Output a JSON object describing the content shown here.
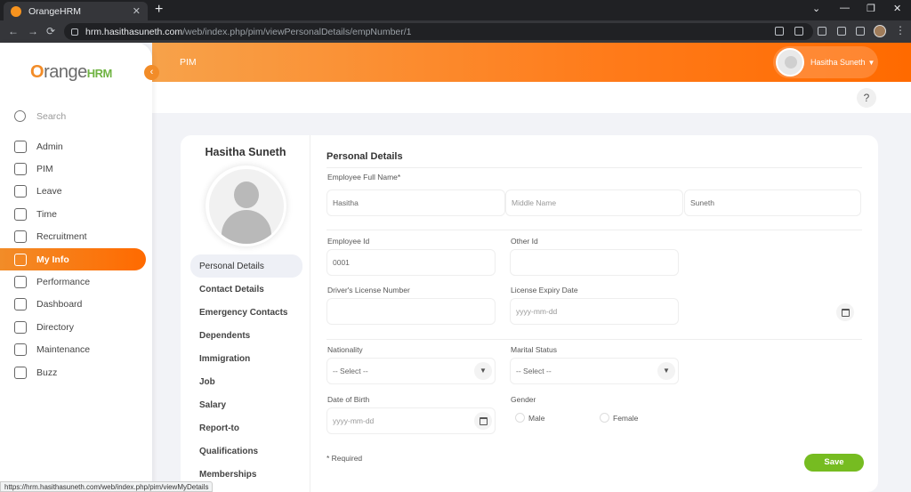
{
  "browser": {
    "tab_title": "OrangeHRM",
    "tab_close": "✕",
    "new_tab": "+",
    "url_host": "hrm.hasithasuneth.com",
    "url_path": "/web/index.php/pim/viewPersonalDetails/empNumber/1",
    "status_url": "https://hrm.hasithasuneth.com/web/index.php/pim/viewMyDetails",
    "controls": {
      "minimize": "—",
      "maximize": "❐",
      "close": "✕",
      "expand": "⌄"
    },
    "nav": {
      "back": "←",
      "forward": "→",
      "reload": "⟳"
    },
    "menu": "⋮"
  },
  "sidebar": {
    "logo_o": "O",
    "logo_text": "range",
    "logo_hrm": "HRM",
    "collapse": "‹",
    "search_placeholder": "Search",
    "items": [
      {
        "label": "Admin"
      },
      {
        "label": "PIM"
      },
      {
        "label": "Leave"
      },
      {
        "label": "Time"
      },
      {
        "label": "Recruitment"
      },
      {
        "label": "My Info",
        "active": true
      },
      {
        "label": "Performance"
      },
      {
        "label": "Dashboard"
      },
      {
        "label": "Directory"
      },
      {
        "label": "Maintenance"
      },
      {
        "label": "Buzz"
      }
    ]
  },
  "header": {
    "module": "PIM",
    "user_name": "Hasitha Suneth",
    "caret": "▼",
    "help": "?"
  },
  "profile": {
    "name": "Hasitha Suneth",
    "tabs": [
      {
        "label": "Personal Details",
        "active": true
      },
      {
        "label": "Contact Details"
      },
      {
        "label": "Emergency Contacts"
      },
      {
        "label": "Dependents"
      },
      {
        "label": "Immigration"
      },
      {
        "label": "Job"
      },
      {
        "label": "Salary"
      },
      {
        "label": "Report-to"
      },
      {
        "label": "Qualifications"
      },
      {
        "label": "Memberships"
      }
    ]
  },
  "form": {
    "title": "Personal Details",
    "full_name_label": "Employee Full Name*",
    "first_name": "Hasitha",
    "middle_name_placeholder": "Middle Name",
    "last_name": "Suneth",
    "employee_id_label": "Employee Id",
    "employee_id": "0001",
    "other_id_label": "Other Id",
    "other_id": "",
    "license_label": "Driver's License Number",
    "license": "",
    "license_expiry_label": "License Expiry Date",
    "license_expiry_placeholder": "yyyy-mm-dd",
    "nationality_label": "Nationality",
    "nationality_value": "-- Select --",
    "marital_label": "Marital Status",
    "marital_value": "-- Select --",
    "dob_label": "Date of Birth",
    "dob_placeholder": "yyyy-mm-dd",
    "gender_label": "Gender",
    "gender_male": "Male",
    "gender_female": "Female",
    "select_arrow": "▼",
    "required_note": "* Required",
    "save_label": "Save"
  }
}
